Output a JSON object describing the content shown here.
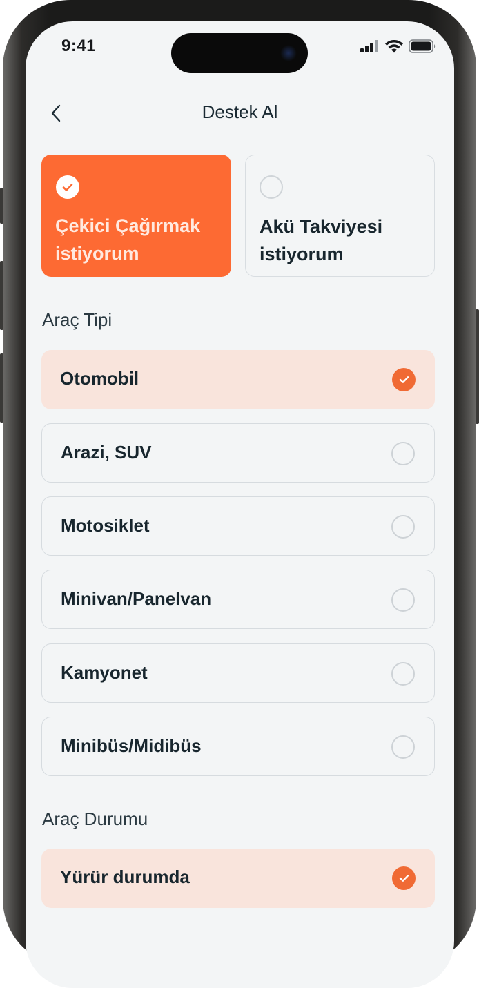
{
  "status_bar": {
    "time": "9:41",
    "icons": [
      "signal-icon",
      "wifi-icon",
      "battery-icon"
    ]
  },
  "header": {
    "title": "Destek Al",
    "back_icon": "chevron-left-icon"
  },
  "service_choices": [
    {
      "label": "Çekici Çağırmak istiyorum",
      "selected": true
    },
    {
      "label": "Akü Takviyesi istiyorum",
      "selected": false
    }
  ],
  "vehicle_type": {
    "title": "Araç Tipi",
    "options": [
      {
        "label": "Otomobil",
        "selected": true
      },
      {
        "label": "Arazi, SUV",
        "selected": false
      },
      {
        "label": "Motosiklet",
        "selected": false
      },
      {
        "label": "Minivan/Panelvan",
        "selected": false
      },
      {
        "label": "Kamyonet",
        "selected": false
      },
      {
        "label": "Minibüs/Midibüs",
        "selected": false
      }
    ]
  },
  "vehicle_status": {
    "title": "Araç Durumu",
    "options": [
      {
        "label": "Yürür durumda",
        "selected": true
      }
    ]
  },
  "colors": {
    "accent": "#fd6a33",
    "selected_row_bg": "#f9e4dc",
    "screen_bg": "#f3f5f6",
    "text_dark": "#18262e",
    "border": "#d6dbdf"
  }
}
